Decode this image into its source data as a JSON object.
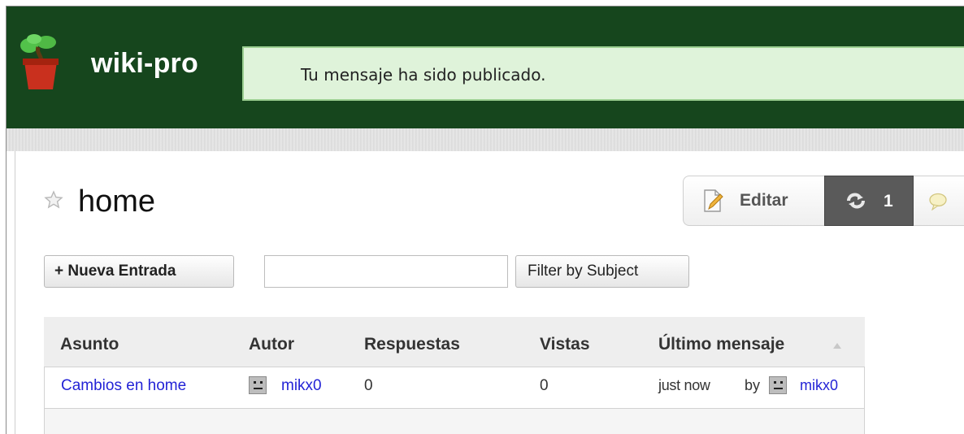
{
  "site": {
    "title": "wiki-pro"
  },
  "notice": {
    "message": "Tu mensaje ha sido publicado."
  },
  "page": {
    "title": "home"
  },
  "toolbar": {
    "edit_label": "Editar",
    "versions_count": "1"
  },
  "actions": {
    "new_entry_label": "+ Nueva Entrada",
    "filter_button_label": "Filter by Subject",
    "filter_input_value": ""
  },
  "table": {
    "headers": [
      "Asunto",
      "Autor",
      "Respuestas",
      "Vistas",
      "Último mensaje"
    ],
    "rows": [
      {
        "subject": "Cambios en home",
        "author": "mikx0",
        "replies": "0",
        "views": "0",
        "last_time": "just now",
        "last_by": "by",
        "last_author": "mikx0"
      }
    ]
  },
  "colors": {
    "header_bg": "#16461d",
    "notice_bg": "#dff3da",
    "link": "#2323d6"
  }
}
